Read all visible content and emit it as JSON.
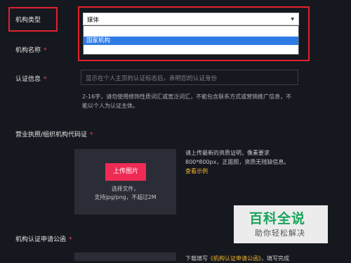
{
  "form": {
    "org_type": {
      "label": "机构类型",
      "value": "媒体",
      "arrow": "▼",
      "dropdown_option": "国家机构"
    },
    "org_name": {
      "label": "机构名称",
      "required": "*"
    },
    "cert_info": {
      "label": "认证信息",
      "required": "*",
      "placeholder": "显示在个人主页的认证标志后，表明您的认证身份",
      "hint_line1": "2-16字，请勿使用修饰性质词汇或宽泛词汇，不能包含联系方式或营销推广信息，不",
      "hint_line2": "能以个人为认证主体。"
    },
    "license": {
      "label": "营业执照/组织机构代码证",
      "required": "*",
      "upload_button": "上传图片",
      "upload_sub1": "选择文件，",
      "upload_sub2": "支持jpg/png，不超过2M",
      "desc_line1": "请上传最新的资质证明，像素要求",
      "desc_line2": "800*800px，正面照，资质无残缺信息。",
      "example_link": "查看示例"
    },
    "application": {
      "label": "机构认证申请公函",
      "required": "*",
      "desc_prefix": "下载填写",
      "desc_link": "《机构认证申请公函》",
      "desc_suffix": "，填写完成"
    }
  },
  "watermark": {
    "title": "百科全说",
    "subtitle": "助你轻松解决"
  }
}
